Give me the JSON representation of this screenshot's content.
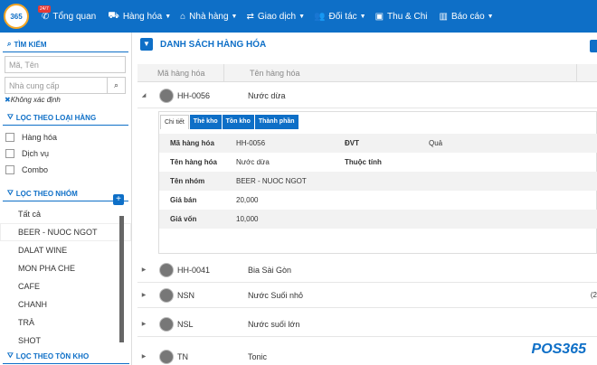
{
  "app": {
    "logo_text": "365",
    "badge": "24/7"
  },
  "nav": [
    {
      "icon": "phone-icon",
      "glyph": "✆",
      "label": "Tổng quan",
      "caret": ""
    },
    {
      "icon": "box-icon",
      "glyph": "⛟",
      "label": "Hàng hóa",
      "caret": "▼"
    },
    {
      "icon": "home-icon",
      "glyph": "⌂",
      "label": "Nhà hàng",
      "caret": "▼"
    },
    {
      "icon": "exchange-icon",
      "glyph": "⇄",
      "label": "Giao dịch",
      "caret": "▼"
    },
    {
      "icon": "users-icon",
      "glyph": "👥",
      "label": "Đối tác",
      "caret": "▼"
    },
    {
      "icon": "money-icon",
      "glyph": "▣",
      "label": "Thu & Chi",
      "caret": ""
    },
    {
      "icon": "chart-icon",
      "glyph": "▥",
      "label": "Báo cáo",
      "caret": "▼"
    }
  ],
  "sidebar": {
    "search": {
      "title": "TÌM KIẾM",
      "code_placeholder": "Mã, Tên",
      "supplier_placeholder": "Nhà cung cấp",
      "unknown_x": "✖",
      "unknown_label": "Không xác định"
    },
    "type_filter": {
      "title": "LỌC THEO LOẠI HÀNG",
      "items": [
        "Hàng hóa",
        "Dịch vụ",
        "Combo"
      ]
    },
    "group_filter": {
      "title": "LỌC THEO NHÓM",
      "items": [
        "Tất cả",
        "BEER - NUOC NGOT",
        "DALAT WINE",
        "MON PHA CHE",
        "CAFE",
        "CHANH",
        "TRÀ",
        "SHOT"
      ],
      "selected": 1
    },
    "stock_filter": {
      "title": "LỌC THEO TỒN KHO"
    }
  },
  "main": {
    "title": "DANH SÁCH HÀNG HÓA",
    "columns": {
      "code": "Mã hàng hóa",
      "name": "Tên hàng hóa"
    },
    "rows": [
      {
        "code": "HH-0056",
        "name": "Nước dừa",
        "expanded": true,
        "extra": ""
      },
      {
        "code": "HH-0041",
        "name": "Bia Sài Gòn",
        "expanded": false,
        "extra": ""
      },
      {
        "code": "NSN",
        "name": "Nước Suối nhỏ",
        "expanded": false,
        "extra": "(2"
      },
      {
        "code": "NSL",
        "name": "Nước suối lớn",
        "expanded": false,
        "extra": ""
      },
      {
        "code": "TN",
        "name": "Tonic",
        "expanded": false,
        "extra": ""
      }
    ],
    "detail": {
      "tabs": [
        "Chi tiết",
        "Thẻ kho",
        "Tồn kho",
        "Thành phần"
      ],
      "fields": [
        {
          "label": "Mã hàng hóa",
          "value": "HH-0056",
          "label2": "ĐVT",
          "value2": "Quả"
        },
        {
          "label": "Tên hàng hóa",
          "value": "Nước dừa",
          "label2": "Thuộc tính",
          "value2": ""
        },
        {
          "label": "Tên nhóm",
          "value": "BEER - NUOC NGOT",
          "label2": "",
          "value2": ""
        },
        {
          "label": "Giá bán",
          "value": "20,000",
          "label2": "",
          "value2": ""
        },
        {
          "label": "Giá vốn",
          "value": "10,000",
          "label2": "",
          "value2": ""
        }
      ]
    }
  },
  "watermark": "POS365"
}
